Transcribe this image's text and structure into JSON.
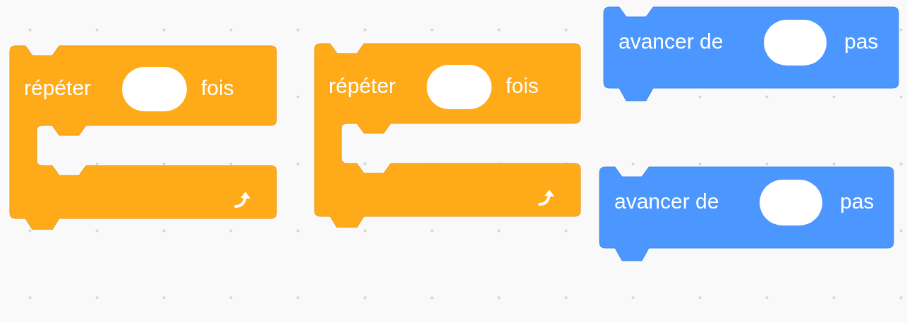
{
  "blocks": [
    {
      "kind": "repeat",
      "label": "répéter",
      "suffix": "fois"
    },
    {
      "kind": "repeat",
      "label": "répéter",
      "suffix": "fois"
    },
    {
      "kind": "move",
      "label": "avancer de",
      "suffix": "pas"
    },
    {
      "kind": "move",
      "label": "avancer de",
      "suffix": "pas"
    }
  ]
}
